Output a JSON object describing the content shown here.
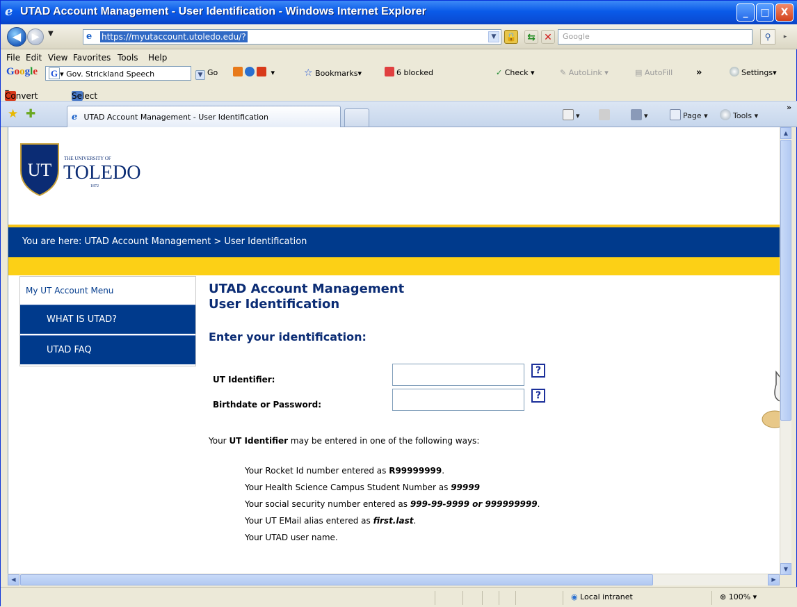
{
  "window": {
    "title": "UTAD Account Management - User Identification - Windows Internet Explorer",
    "controls": {
      "minimize": "_",
      "maximize": "□",
      "close": "X"
    }
  },
  "address_bar": {
    "url": "https://myutaccount.utoledo.edu/?",
    "search_placeholder": "Google"
  },
  "menu": [
    "File",
    "Edit",
    "View",
    "Favorites",
    "Tools",
    "Help"
  ],
  "google_toolbar": {
    "search_value": "Gov. Strickland Speech",
    "go_label": "Go",
    "bookmarks_label": "Bookmarks",
    "blocked_label": "6 blocked",
    "check_label": "Check",
    "autolink_label": "AutoLink",
    "autofill_label": "AutoFill",
    "more_label": "»",
    "settings_label": "Settings"
  },
  "convert_bar": {
    "convert_label": "Convert",
    "select_label": "Select"
  },
  "tab": {
    "label": "UTAD Account Management - User Identification"
  },
  "command_bar": {
    "page_label": "Page",
    "tools_label": "Tools",
    "more_label": "»"
  },
  "page": {
    "logo": {
      "monogram": "UT",
      "small": "THE UNIVERSITY OF",
      "name": "TOLEDO",
      "year": "1872"
    },
    "breadcrumb": "You are here:  UTAD Account Management > User Identification",
    "side_menu": {
      "heading": "My UT Account Menu",
      "items": [
        "WHAT IS UTAD?",
        "UTAD FAQ"
      ]
    },
    "heading_line1": "UTAD Account Management",
    "heading_line2": "User Identification",
    "subheading": "Enter your identification:",
    "form": {
      "identifier_label": "UT Identifier:",
      "password_label": "Birthdate or Password:",
      "help_glyph": "?"
    },
    "intro": {
      "prefix": "Your ",
      "bold": "UT Identifier",
      "suffix": " may be entered in one of the following ways:"
    },
    "ways": [
      {
        "text": "Your Rocket Id number entered as ",
        "b": "R99999999",
        "end": "."
      },
      {
        "text": "Your Health Science Campus Student Number as ",
        "bi": "99999"
      },
      {
        "text": "Your social security number entered as ",
        "bi": "999-99-9999 or 999999999",
        "end": "."
      },
      {
        "text": "Your UT EMail alias entered as ",
        "bi": "first.last",
        "end": "."
      },
      {
        "text": "Your UTAD user name."
      }
    ]
  },
  "status_bar": {
    "zone": "Local intranet",
    "zoom": "100%"
  }
}
